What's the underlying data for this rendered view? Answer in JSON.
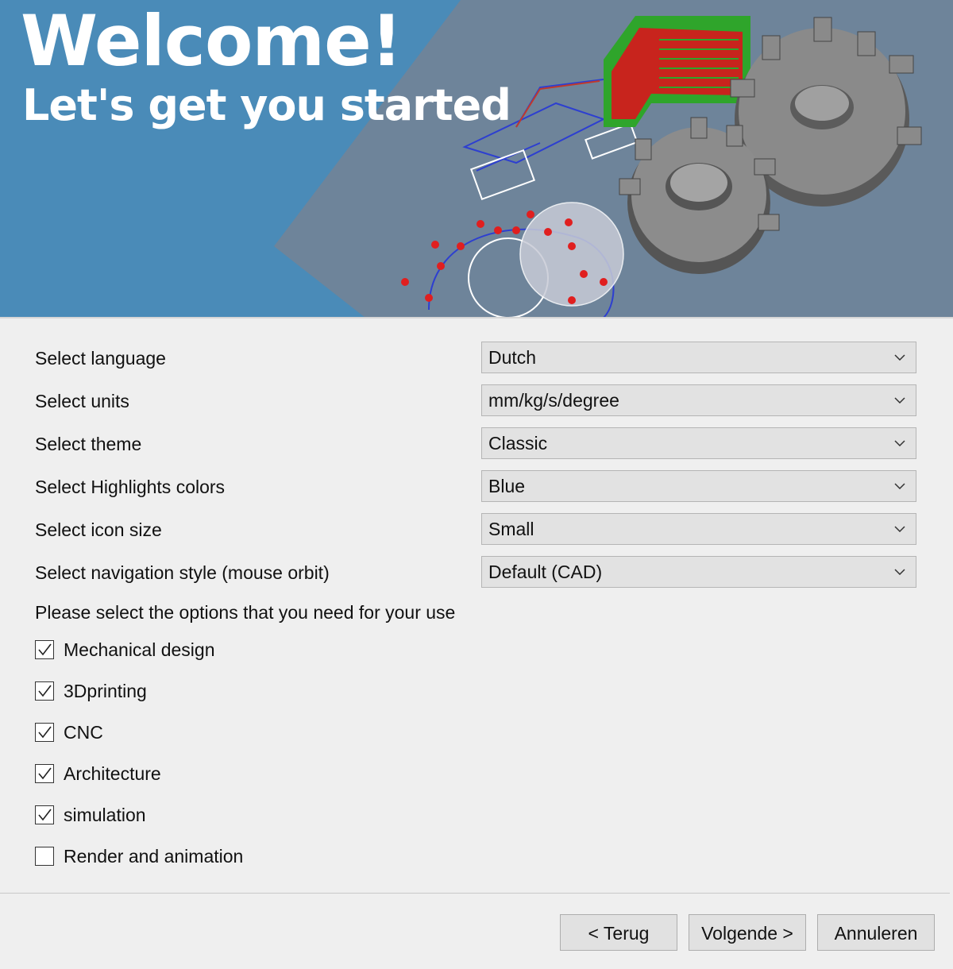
{
  "banner": {
    "title": "Welcome!",
    "subtitle": "Let's get you started"
  },
  "settings": [
    {
      "label": "Select language",
      "value": "Dutch"
    },
    {
      "label": "Select units",
      "value": "mm/kg/s/degree"
    },
    {
      "label": "Select theme",
      "value": "Classic"
    },
    {
      "label": "Select Highlights colors",
      "value": "Blue"
    },
    {
      "label": "Select icon size",
      "value": "Small"
    },
    {
      "label": "Select navigation style (mouse orbit)",
      "value": "Default (CAD)"
    }
  ],
  "options_prompt": "Please select the options that you need for your use",
  "options": [
    {
      "label": "Mechanical design",
      "checked": true
    },
    {
      "label": "3Dprinting",
      "checked": true
    },
    {
      "label": "CNC",
      "checked": true
    },
    {
      "label": "Architecture",
      "checked": true
    },
    {
      "label": "simulation",
      "checked": true
    },
    {
      "label": "Render and animation",
      "checked": false
    }
  ],
  "buttons": {
    "back": "< Terug",
    "next": "Volgende >",
    "cancel": "Annuleren"
  },
  "colors": {
    "banner_blue": "#4a8bb8",
    "banner_gray": "#6e849a",
    "gear": "#7f7f7f",
    "highlight_red": "#d0201b",
    "highlight_green": "#2fa52b"
  }
}
